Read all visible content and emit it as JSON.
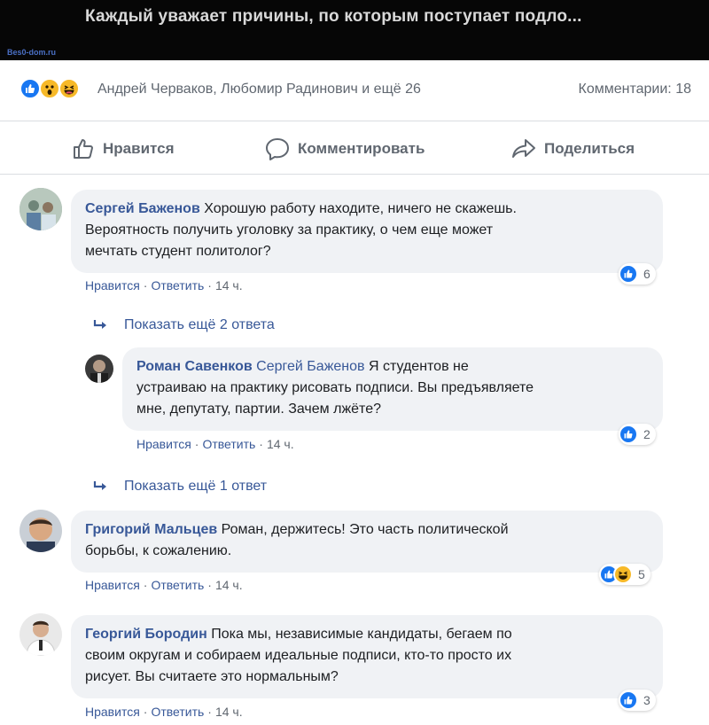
{
  "video": {
    "caption": "Каждый уважает причины, по которым поступает подло...",
    "watermark": "Bes0-dom.ru"
  },
  "post_stats": {
    "reactors": "Андрей Черваков, Любомир Радинович и ещё 26",
    "comments_count": "Комментарии: 18",
    "reaction_icons": [
      "like-icon",
      "wow-icon",
      "haha-icon"
    ]
  },
  "actions": {
    "like": "Нравится",
    "comment": "Комментировать",
    "share": "Поделиться"
  },
  "comment_meta": {
    "like": "Нравится",
    "reply": "Ответить"
  },
  "comments": [
    {
      "author": "Сергей Баженов",
      "text_lines": [
        "Хорошую работу находите, ничего не скажешь.",
        "Вероятность получить уголовку за практику, о чем еще может",
        "мечтать студент политолог?"
      ],
      "time": "14 ч.",
      "reactions": "6"
    },
    {
      "show_more": "Показать ещё 2 ответа"
    },
    {
      "author": "Роман Савенков",
      "mention": "Сергей Баженов",
      "text_lines": [
        "Я студентов не",
        "устраиваю на практику рисовать подписи. Вы предъявляете",
        "мне, депутату, партии. Зачем лжёте?"
      ],
      "time": "14 ч.",
      "reactions": "2"
    },
    {
      "show_more": "Показать ещё 1 ответ"
    },
    {
      "author": "Григорий Мальцев",
      "text_lines": [
        "Роман, держитесь! Это часть политической",
        "борьбы, к сожалению."
      ],
      "time": "14 ч.",
      "reactions": "5"
    },
    {
      "author": "Георгий Бородин",
      "text_lines": [
        "Пока мы, независимые кандидаты, бегаем по",
        "своим округам и собираем идеальные подписи, кто-то просто их",
        "рисует. Вы считаете это нормальным?"
      ],
      "time": "14 ч.",
      "reactions": "3"
    }
  ],
  "colors": {
    "link": "#385898",
    "bubble": "#f0f2f5",
    "like_blue": "#1877f2",
    "emoji_yellow": "#f7b928",
    "muted": "#606770"
  }
}
